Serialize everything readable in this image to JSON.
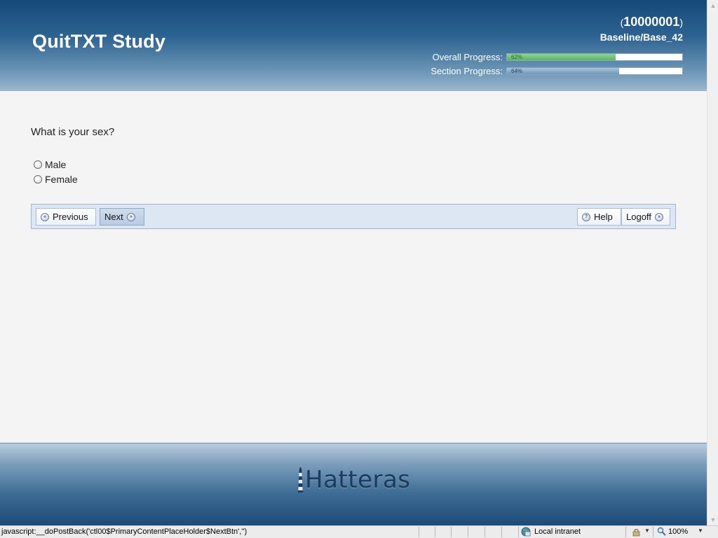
{
  "header": {
    "title": "QuitTXT Study",
    "participant_id": "10000001",
    "paren_open": "(",
    "paren_close": ")",
    "section": "Baseline/Base_42",
    "overall_progress": {
      "label": "Overall Progress:",
      "percent": 62,
      "percent_text": "62%",
      "color": "#5fb55f"
    },
    "section_progress": {
      "label": "Section Progress:",
      "percent": 64,
      "percent_text": "64%",
      "color": "#6f96bb"
    }
  },
  "question": {
    "text": "What is your sex?",
    "options": [
      {
        "label": "Male",
        "selected": false
      },
      {
        "label": "Female",
        "selected": false
      }
    ]
  },
  "nav": {
    "previous_label": "Previous",
    "next_label": "Next",
    "help_label": "Help",
    "logoff_label": "Logoff"
  },
  "footer": {
    "brand": "Hatteras"
  },
  "statusbar": {
    "status_text": "javascript:__doPostBack('ctl00$PrimaryContentPlaceHolder$NextBtn','')",
    "zone": "Local intranet",
    "zoom": "100%"
  },
  "colors": {
    "header_top": "#15497a",
    "header_bottom": "#9bb8cf",
    "navbar_bg": "#dde7f3",
    "page_bg": "#f4f4f4"
  }
}
